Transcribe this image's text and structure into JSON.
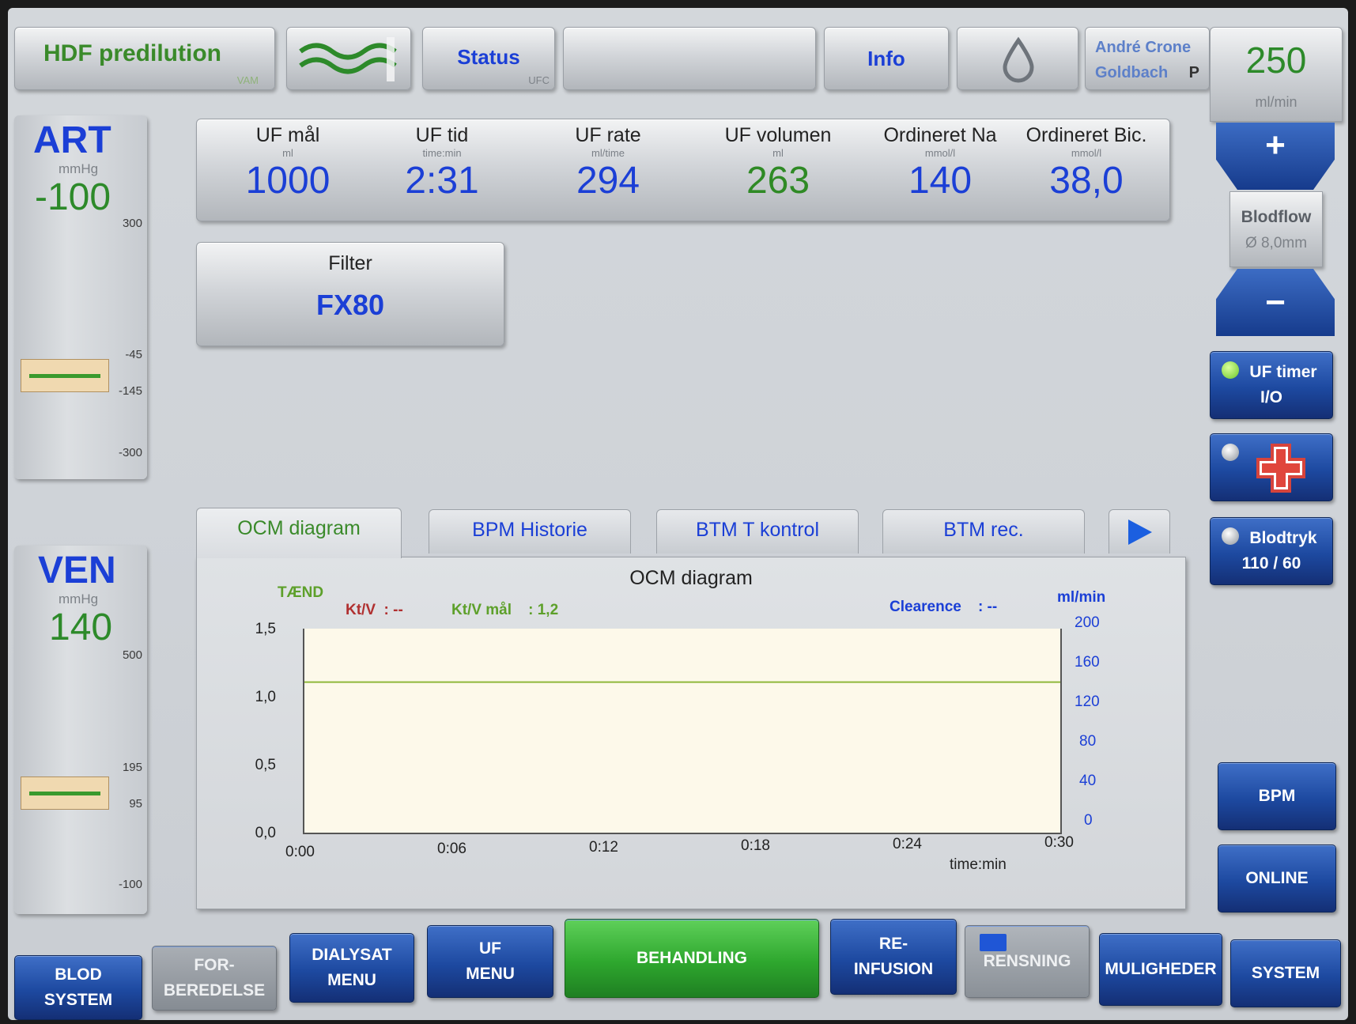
{
  "header": {
    "mode": "HDF predilution",
    "mode_sub": "VAM",
    "status": "Status",
    "status_sub": "UFC",
    "info": "Info",
    "user_name": "André Crone",
    "user_place": "Goldbach",
    "user_flag": "P"
  },
  "bloodflow": {
    "value": "250",
    "unit": "ml/min",
    "label": "Blodflow",
    "sub": "Ø 8,0mm",
    "plus": "+",
    "minus": "−"
  },
  "art": {
    "label": "ART",
    "unit": "mmHg",
    "value": "-100",
    "ticks": [
      "300",
      "-45",
      "-145",
      "-300"
    ]
  },
  "ven": {
    "label": "VEN",
    "unit": "mmHg",
    "value": "140",
    "ticks": [
      "500",
      "195",
      "95",
      "-100"
    ]
  },
  "params": [
    {
      "label": "UF mål",
      "unit": "ml",
      "value": "1000",
      "color": "#1b3fd6"
    },
    {
      "label": "UF tid",
      "unit": "time:min",
      "value": "2:31",
      "color": "#1b3fd6"
    },
    {
      "label": "UF rate",
      "unit": "ml/time",
      "value": "294",
      "color": "#1b3fd6"
    },
    {
      "label": "UF volumen",
      "unit": "ml",
      "value": "263",
      "color": "#2f8a25"
    },
    {
      "label": "Ordineret Na",
      "unit": "mmol/l",
      "value": "140",
      "color": "#1b3fd6"
    },
    {
      "label": "Ordineret Bic.",
      "unit": "mmol/l",
      "value": "38,0",
      "color": "#1b3fd6"
    }
  ],
  "filter": {
    "label": "Filter",
    "value": "FX80"
  },
  "side": {
    "uf_timer": "UF timer",
    "uf_timer_sub": "I/O",
    "blodtryk": "Blodtryk",
    "blodtryk_value": "110 / 60",
    "bpm": "BPM",
    "online": "ONLINE"
  },
  "tabs": [
    "OCM diagram",
    "BPM Historie",
    "BTM T kontrol",
    "BTM rec."
  ],
  "chart_data": {
    "type": "line",
    "title": "OCM diagram",
    "status_label": "TÆND",
    "ktv_label": "Kt/V  : --",
    "ktv_target_label": "Kt/V mål    : 1,2",
    "clearance_label": "Clearence    : --",
    "right_unit": "ml/min",
    "xlabel": "time:min",
    "x_ticks": [
      "0:00",
      "0:06",
      "0:12",
      "0:18",
      "0:24",
      "0:30"
    ],
    "y_left_ticks": [
      "1,5",
      "1,0",
      "0,5",
      "0,0"
    ],
    "y_right_ticks": [
      "200",
      "160",
      "120",
      "80",
      "40",
      "0"
    ],
    "ylim": [
      0,
      1.5
    ],
    "y2lim": [
      0,
      200
    ],
    "xlim_minutes": [
      0,
      30
    ],
    "series": [
      {
        "name": "Kt/V mål",
        "color": "#8fb83a",
        "x": [
          0,
          30
        ],
        "values": [
          1.2,
          1.2
        ]
      }
    ]
  },
  "nav": [
    {
      "l1": "BLOD",
      "l2": "SYSTEM",
      "style": "blue"
    },
    {
      "l1": "FOR-",
      "l2": "BEREDELSE",
      "style": "grey"
    },
    {
      "l1": "DIALYSAT",
      "l2": "MENU",
      "style": "blue"
    },
    {
      "l1": "UF",
      "l2": "MENU",
      "style": "blue"
    },
    {
      "l1": "BEHANDLING",
      "l2": "",
      "style": "green"
    },
    {
      "l1": "RE-",
      "l2": "INFUSION",
      "style": "blue"
    },
    {
      "l1": "RENSNING",
      "l2": "",
      "style": "grey"
    },
    {
      "l1": "MULIGHEDER",
      "l2": "",
      "style": "blue"
    },
    {
      "l1": "SYSTEM",
      "l2": "",
      "style": "blue"
    }
  ]
}
